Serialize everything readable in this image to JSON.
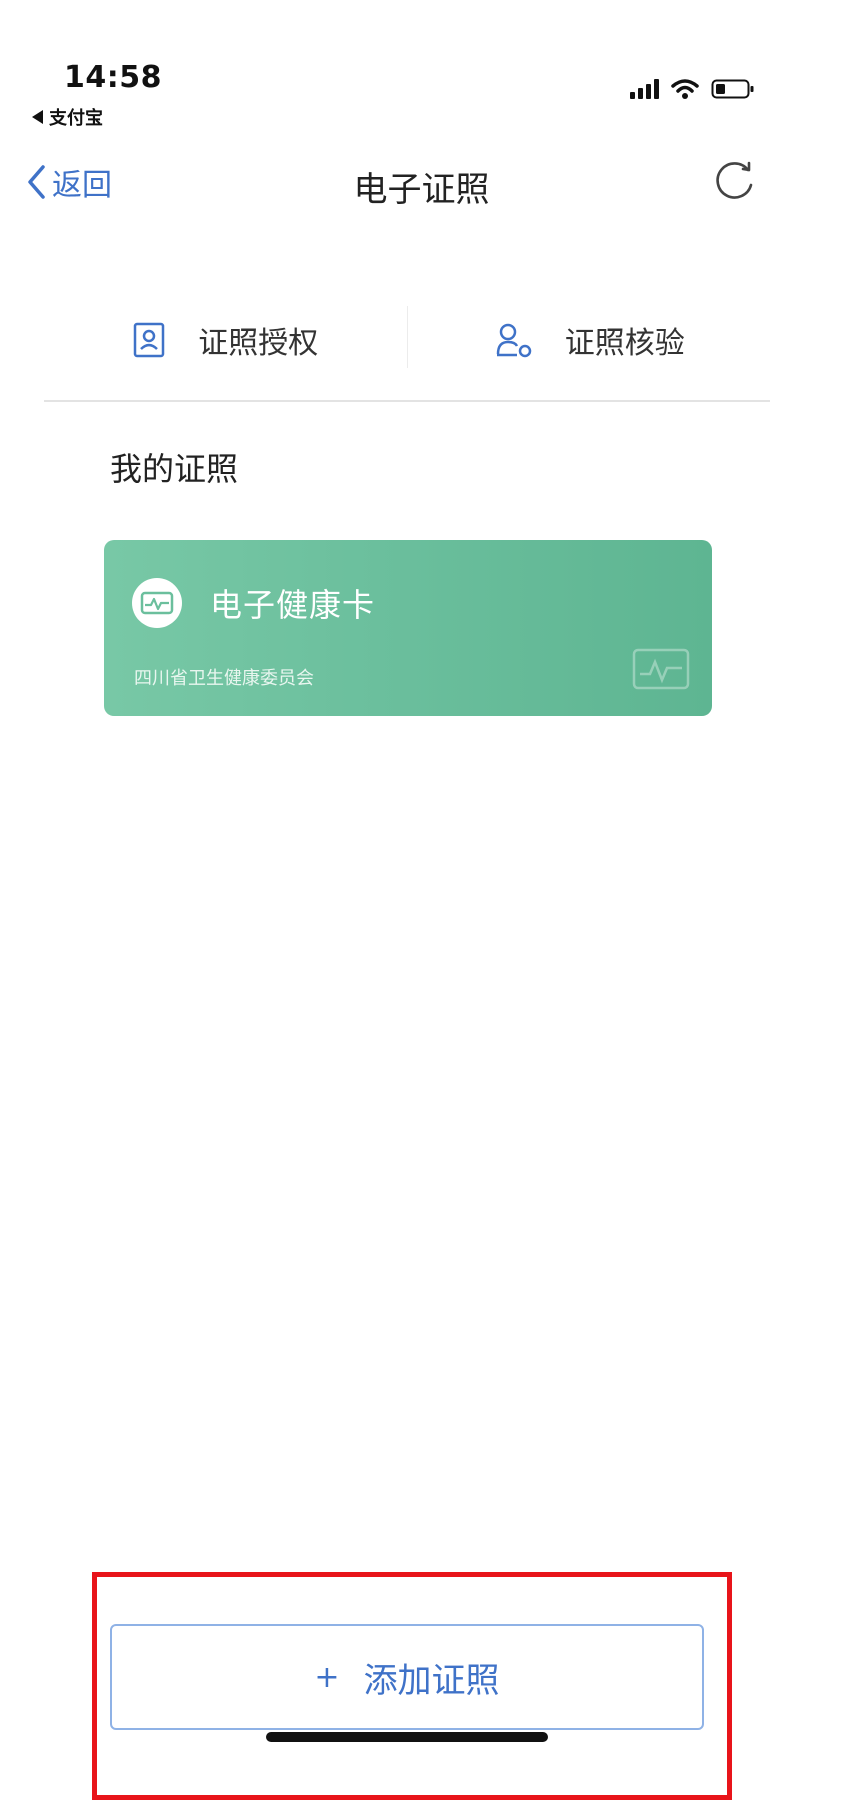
{
  "status_bar": {
    "time": "14:58",
    "back_app": "支付宝"
  },
  "nav": {
    "back_label": "返回",
    "title": "电子证照"
  },
  "actions": [
    {
      "label": "证照授权",
      "icon": "id-card-icon"
    },
    {
      "label": "证照核验",
      "icon": "verify-user-icon"
    }
  ],
  "section_title": "我的证照",
  "card": {
    "title": "电子健康卡",
    "issuer": "四川省卫生健康委员会",
    "icon": "health-card-icon",
    "colors": {
      "start": "#78c8a6",
      "end": "#5eb592"
    }
  },
  "add_button": {
    "plus": "+",
    "label": "添加证照"
  },
  "colors": {
    "accent": "#3f72c8",
    "highlight": "#e8141a"
  }
}
